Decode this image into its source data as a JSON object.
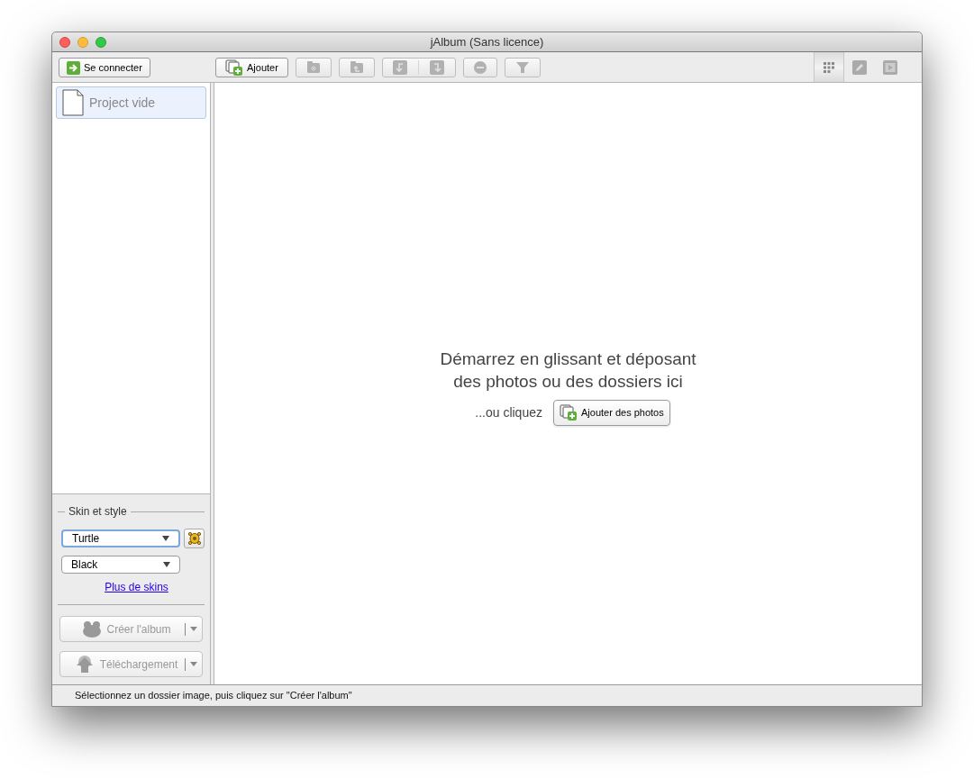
{
  "window": {
    "title": "jAlbum (Sans licence)"
  },
  "toolbar": {
    "login_button": "Se connecter",
    "add_button": "Ajouter",
    "tools": [
      {
        "kind": "new-folder",
        "disabled": true
      },
      {
        "kind": "parent-folder",
        "disabled": true
      },
      {
        "kind": "rotate-pair",
        "disabled": true
      },
      {
        "kind": "remove",
        "disabled": true
      },
      {
        "kind": "filter",
        "disabled": true
      }
    ],
    "view_modes": [
      {
        "kind": "grid",
        "selected": true
      },
      {
        "kind": "edit",
        "selected": false
      },
      {
        "kind": "slideshow",
        "selected": false
      }
    ]
  },
  "sidebar": {
    "projects": [
      {
        "label": "Project vide",
        "selected": true
      }
    ],
    "skin_section": {
      "legend": "Skin et style",
      "skin": {
        "value": "Turtle",
        "focused": true
      },
      "style": {
        "value": "Black"
      },
      "link": "Plus de skins"
    },
    "actions": [
      {
        "kind": "create",
        "label": "Créer l'album",
        "disabled": true
      },
      {
        "kind": "upload",
        "label": "Téléchargement",
        "disabled": true
      }
    ]
  },
  "main": {
    "message_lines": [
      "Démarrez en glissant et déposant",
      "des photos ou des dossiers ici"
    ],
    "or_click": "...ou cliquez",
    "add_photos_button": "Ajouter des photos"
  },
  "status_bar": "Sélectionnez un dossier image, puis cliquez sur \"Créer l'album\""
}
